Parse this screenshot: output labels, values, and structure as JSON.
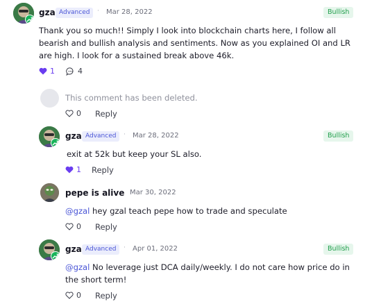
{
  "comments": [
    {
      "author": "gzal",
      "badge": "Advanced",
      "separator": "·",
      "date": "Mar 28, 2022",
      "sentiment": "Bullish",
      "text": "Thank you so much!! Simply I look into blockchain charts here, I follow all bearish and bullish analysis and sentiments. Now as you explained OI and LR are high. I look for a sustained break above 46k.",
      "likes": "1",
      "replies": "4"
    },
    {
      "deleted_text": "This comment has been deleted.",
      "likes": "0",
      "reply_label": "Reply"
    },
    {
      "author": "gzal",
      "badge": "Advanced",
      "separator": "·",
      "date": "Mar 28, 2022",
      "sentiment": "Bullish",
      "text": "exit at 52k but keep your SL also.",
      "likes": "1",
      "reply_label": "Reply"
    },
    {
      "author": "pepe is alive",
      "separator": "·",
      "date": "Mar 30, 2022",
      "mention": "@gzal",
      "text": " hey gzal teach pepe how to trade and speculate",
      "likes": "0",
      "reply_label": "Reply"
    },
    {
      "author": "gzal",
      "badge": "Advanced",
      "separator": "·",
      "date": "Apr 01, 2022",
      "sentiment": "Bullish",
      "mention": "@gzal",
      "text": " No  leverage just DCA daily/weekly. I do not care how price do in the short term!",
      "likes": "0",
      "reply_label": "Reply"
    }
  ],
  "colors": {
    "accent": "#4a55d6",
    "bullish": "#1f9d4a",
    "liked_heart": "#6a3df0"
  }
}
